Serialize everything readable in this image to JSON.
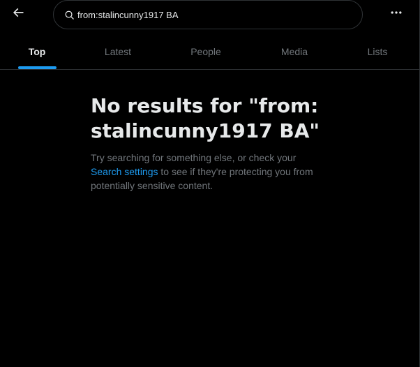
{
  "header": {
    "search_value": "from:stalincunny1917 BA"
  },
  "tabs": [
    {
      "label": "Top",
      "active": true
    },
    {
      "label": "Latest",
      "active": false
    },
    {
      "label": "People",
      "active": false
    },
    {
      "label": "Media",
      "active": false
    },
    {
      "label": "Lists",
      "active": false
    }
  ],
  "empty_state": {
    "title": "No results for \"from:stalincunny1917 BA\"",
    "body_before": "Try searching for something else, or check your ",
    "link_text": "Search settings",
    "body_after": " to see if they're protecting you from potentially sensitive content."
  },
  "icons": {
    "back": "arrow-left-icon",
    "search": "magnifier-icon",
    "more": "ellipsis-icon"
  },
  "colors": {
    "background": "#000000",
    "text_primary": "#e7e9ea",
    "text_secondary": "#71767b",
    "accent": "#1d9bf0",
    "border": "#2f3336"
  }
}
